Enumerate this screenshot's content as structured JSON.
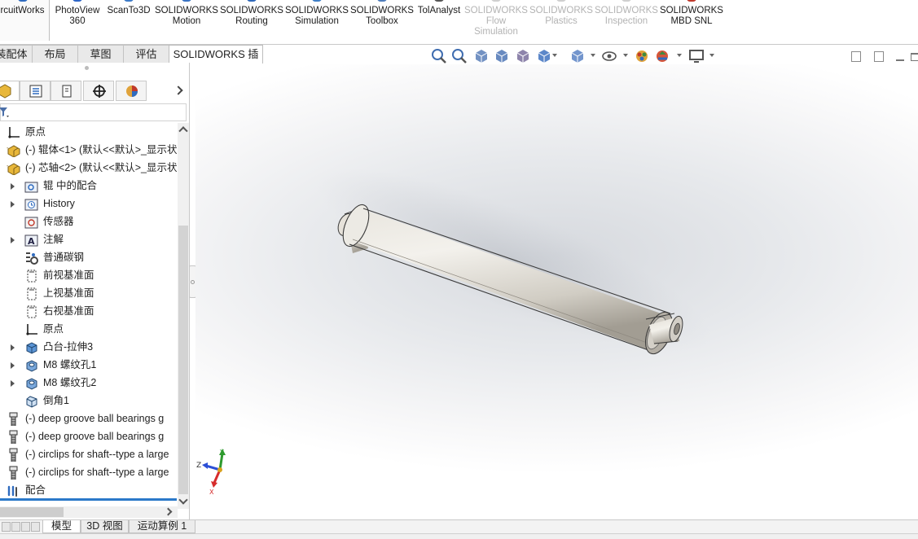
{
  "ribbon": {
    "items": [
      {
        "l1": "rcuitWorks",
        "l2": "",
        "l3": "",
        "disabled": false,
        "selected": true,
        "icon_color": "#2f6bbf"
      },
      {
        "l1": "PhotoView",
        "l2": "360",
        "l3": "",
        "disabled": false,
        "selected": false,
        "icon_color": "#2e66c7"
      },
      {
        "l1": "ScanTo3D",
        "l2": "",
        "l3": "",
        "disabled": false,
        "selected": false,
        "icon_color": "#3d7bc8"
      },
      {
        "l1": "SOLIDWORKS",
        "l2": "Motion",
        "l3": "",
        "disabled": false,
        "selected": false,
        "icon_color": "#3a73c3"
      },
      {
        "l1": "SOLIDWORKS",
        "l2": "Routing",
        "l3": "",
        "disabled": false,
        "selected": false,
        "icon_color": "#2f68b9"
      },
      {
        "l1": "SOLIDWORKS",
        "l2": "Simulation",
        "l3": "",
        "disabled": false,
        "selected": false,
        "icon_color": "#3f7fc7"
      },
      {
        "l1": "SOLIDWORKS",
        "l2": "Toolbox",
        "l3": "",
        "disabled": false,
        "selected": false,
        "icon_color": "#4f7dbb"
      },
      {
        "l1": "TolAnalyst",
        "l2": "",
        "l3": "",
        "disabled": false,
        "selected": false,
        "icon_color": "#555555"
      },
      {
        "l1": "SOLIDWORKS",
        "l2": "Flow",
        "l3": "Simulation",
        "disabled": true,
        "selected": false,
        "icon_color": "#cfcfcf"
      },
      {
        "l1": "SOLIDWORKS",
        "l2": "Plastics",
        "l3": "",
        "disabled": true,
        "selected": false,
        "icon_color": "#cfcfcf"
      },
      {
        "l1": "SOLIDWORKS",
        "l2": "Inspection",
        "l3": "",
        "disabled": true,
        "selected": false,
        "icon_color": "#cfcfcf"
      },
      {
        "l1": "SOLIDWORKS",
        "l2": "MBD SNL",
        "l3": "",
        "disabled": false,
        "selected": false,
        "icon_color": "#c0392b"
      }
    ]
  },
  "command_tabs": [
    {
      "label": "装配体",
      "active": false
    },
    {
      "label": "布局",
      "active": false
    },
    {
      "label": "草图",
      "active": false
    },
    {
      "label": "评估",
      "active": false
    },
    {
      "label": "SOLIDWORKS 插件",
      "active": true
    }
  ],
  "heads_up_toolbar": {
    "icons": [
      "zoom-to-fit-icon",
      "zoom-to-area-icon",
      "previous-view-icon",
      "section-view-icon",
      "dynamic-annotation-icon",
      "view-orientation-icon",
      "display-style-icon",
      "hide-show-items-icon",
      "edit-appearance-icon",
      "apply-scene-icon",
      "view-settings-icon"
    ]
  },
  "feature_manager": {
    "tabs": [
      "featuremanager-tab",
      "propertymanager-tab",
      "configurationmanager-tab",
      "dimxpertmanager-tab",
      "displaymanager-tab"
    ],
    "tree": [
      {
        "label": "原点",
        "icon": "origin-icon",
        "indent": 0,
        "expandable": false
      },
      {
        "label": "(-) 辊体<1> (默认<<默认>_显示状",
        "icon": "part-icon",
        "indent": 0,
        "expandable": false
      },
      {
        "label": "(-) 芯轴<2> (默认<<默认>_显示状",
        "icon": "part-icon",
        "indent": 0,
        "expandable": false
      },
      {
        "label": "辊 中的配合",
        "icon": "mates-folder-icon",
        "indent": 1,
        "expandable": true
      },
      {
        "label": "History",
        "icon": "history-icon",
        "indent": 1,
        "expandable": true
      },
      {
        "label": "传感器",
        "icon": "sensor-icon",
        "indent": 1,
        "expandable": false
      },
      {
        "label": "注解",
        "icon": "annotation-icon",
        "indent": 1,
        "expandable": true
      },
      {
        "label": "普通碳钢",
        "icon": "material-icon",
        "indent": 1,
        "expandable": false
      },
      {
        "label": "前视基准面",
        "icon": "plane-icon",
        "indent": 1,
        "expandable": false
      },
      {
        "label": "上视基准面",
        "icon": "plane-icon",
        "indent": 1,
        "expandable": false
      },
      {
        "label": "右视基准面",
        "icon": "plane-icon",
        "indent": 1,
        "expandable": false
      },
      {
        "label": "原点",
        "icon": "origin-icon",
        "indent": 1,
        "expandable": false
      },
      {
        "label": "凸台-拉伸3",
        "icon": "extrude-icon",
        "indent": 1,
        "expandable": true
      },
      {
        "label": "M8 螺纹孔1",
        "icon": "hole-wizard-icon",
        "indent": 1,
        "expandable": true
      },
      {
        "label": "M8 螺纹孔2",
        "icon": "hole-wizard-icon",
        "indent": 1,
        "expandable": true
      },
      {
        "label": "倒角1",
        "icon": "chamfer-icon",
        "indent": 1,
        "expandable": false
      },
      {
        "label": "(-) deep groove ball bearings g",
        "icon": "toolbox-part-icon",
        "indent": 0,
        "expandable": false
      },
      {
        "label": "(-) deep groove ball bearings g",
        "icon": "toolbox-part-icon",
        "indent": 0,
        "expandable": false
      },
      {
        "label": "(-) circlips for shaft--type a large",
        "icon": "toolbox-part-icon",
        "indent": 0,
        "expandable": false
      },
      {
        "label": "(-) circlips for shaft--type a large",
        "icon": "toolbox-part-icon",
        "indent": 0,
        "expandable": false
      },
      {
        "label": "配合",
        "icon": "mates-icon",
        "indent": 0,
        "expandable": false
      }
    ]
  },
  "triad": {
    "x_label": "X",
    "y_label": "Y",
    "z_label": "Z"
  },
  "bottom_tabs": [
    {
      "label": "模型",
      "active": true
    },
    {
      "label": "3D 视图",
      "active": false
    },
    {
      "label": "运动算例 1",
      "active": false
    }
  ],
  "colors": {
    "accent_blue": "#2b79c9",
    "part_yellow": "#e8b73a"
  }
}
